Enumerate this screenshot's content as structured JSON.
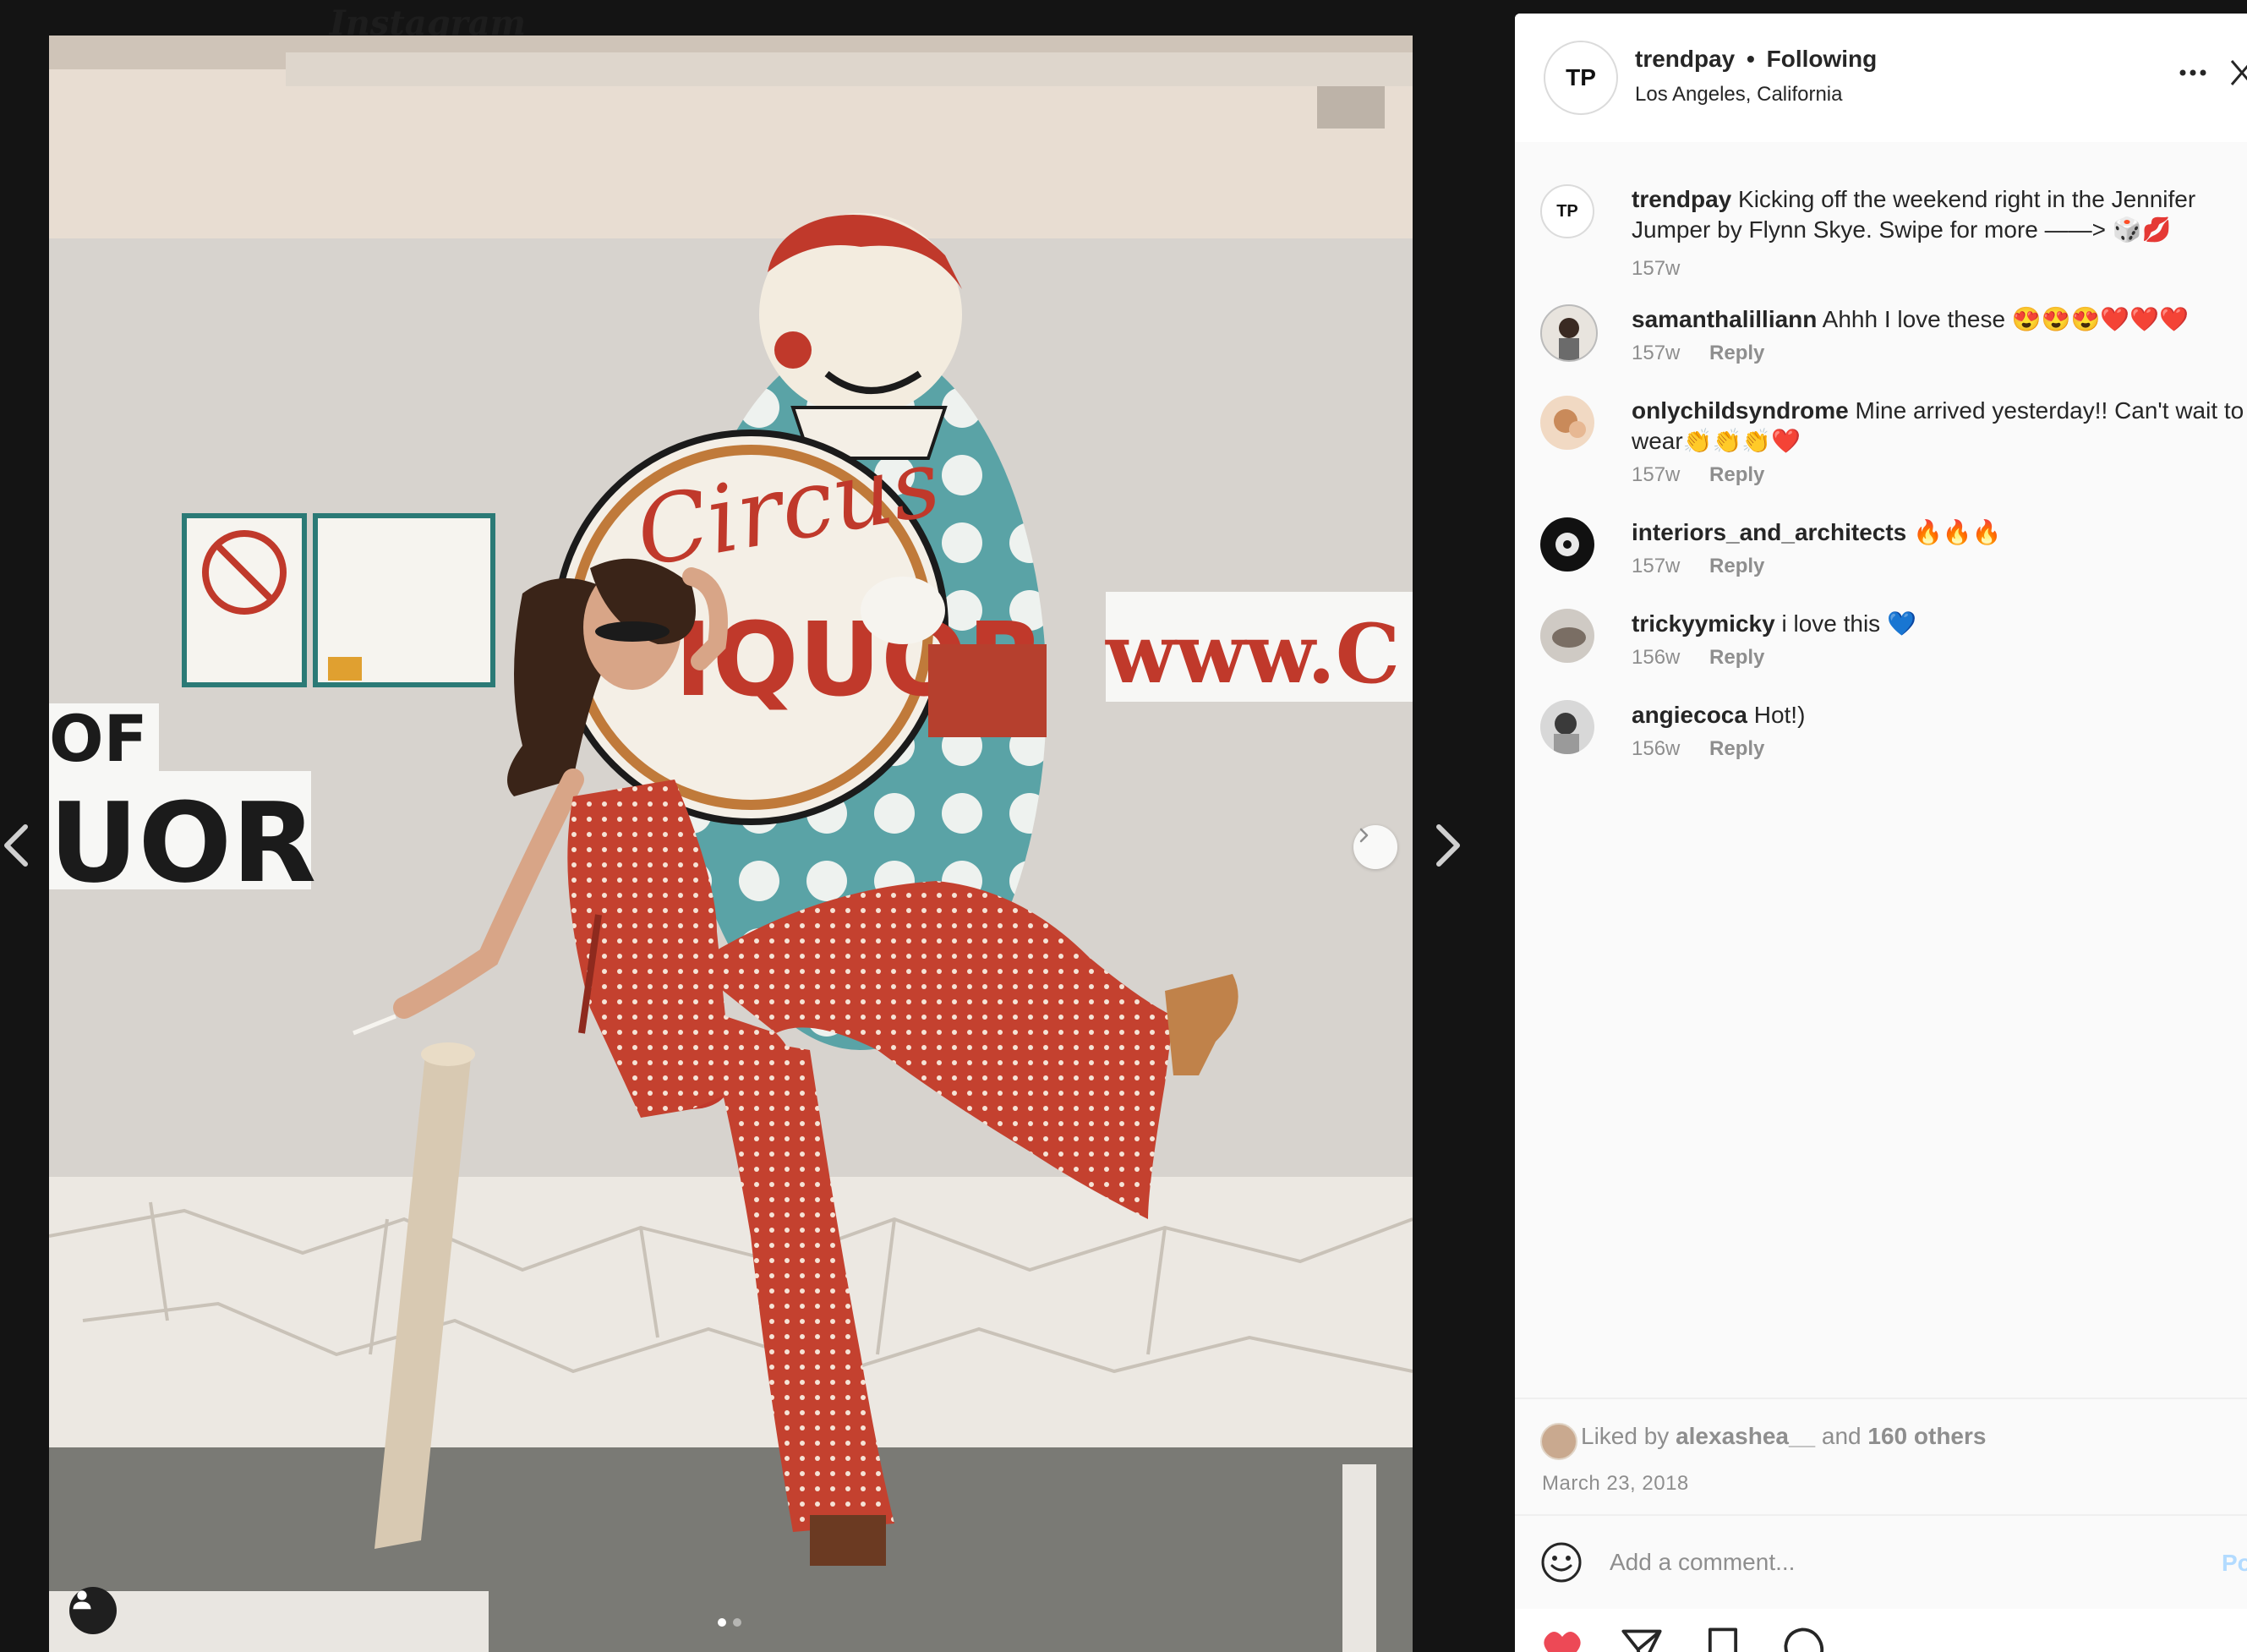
{
  "background": {
    "app_wordmark": "Instagram"
  },
  "photo": {
    "carousel_total": 2,
    "carousel_index": 1
  },
  "post": {
    "username": "trendpay",
    "avatar_initials": "TP",
    "separator": "•",
    "follow_status": "Following",
    "location": "Los Angeles, California",
    "caption": {
      "username": "trendpay",
      "text": "Kicking off the weekend right in the Jennifer Jumper by Flynn Skye. Swipe for more ——> 🎲💋",
      "time": "157w"
    }
  },
  "comments": [
    {
      "username": "samanthalilliann",
      "text": "Ahhh I love these 😍😍😍❤️❤️❤️",
      "time": "157w",
      "reply": "Reply"
    },
    {
      "username": "onlychildsyndrome",
      "text": "Mine arrived yesterday!! Can't wait to wear👏👏👏❤️",
      "time": "157w",
      "reply": "Reply"
    },
    {
      "username": "interiors_and_architects",
      "text": "🔥🔥🔥",
      "time": "157w",
      "reply": "Reply"
    },
    {
      "username": "trickyymicky",
      "text": "i love this 💙",
      "time": "156w",
      "reply": "Reply"
    },
    {
      "username": "angiecoca",
      "text": "Hot!)",
      "time": "156w",
      "reply": "Reply"
    }
  ],
  "likes": {
    "prefix": "Liked by",
    "user": "alexashea__",
    "and": "and",
    "others": "160 others"
  },
  "date": "March 23, 2018",
  "add_comment": {
    "placeholder": "Add a comment...",
    "post_label": "Post"
  },
  "icons": {
    "like": "heart-icon",
    "comment": "comment-icon",
    "share": "paper-plane-icon",
    "save": "bookmark-icon",
    "more": "more-options-icon",
    "close": "close-icon",
    "emoji": "emoji-icon"
  },
  "colors": {
    "like_red": "#ed4956",
    "post_blue": "#0095f6",
    "meta_gray": "#8e8e8e"
  }
}
